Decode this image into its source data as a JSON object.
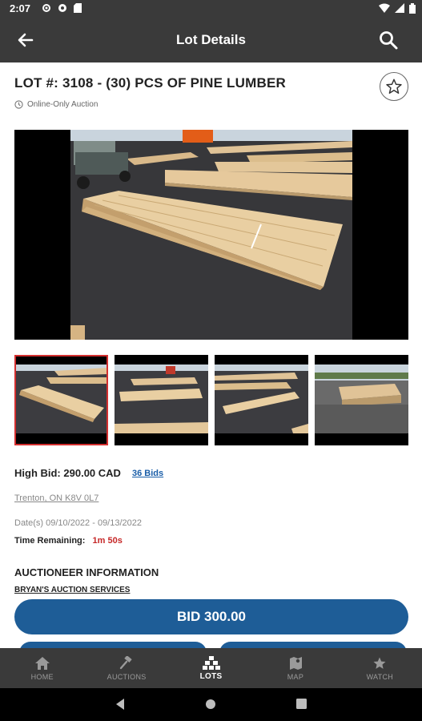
{
  "status_bar": {
    "time": "2:07"
  },
  "app_bar": {
    "title": "Lot Details"
  },
  "lot": {
    "title": "LOT #: 3108 - (30) PCS OF PINE LUMBER",
    "auction_type": "Online-Only Auction",
    "high_bid_label": "High Bid:",
    "high_bid_value": "290.00 CAD",
    "bids_link": "36 Bids",
    "location": "Trenton, ON K8V 0L7",
    "dates": "Date(s) 09/10/2022 - 09/13/2022",
    "time_remaining_label": "Time Remaining:",
    "time_remaining_value": "1m  50s"
  },
  "auctioneer": {
    "heading": "AUCTIONEER INFORMATION",
    "name": "BRYAN'S AUCTION SERVICES"
  },
  "bid_button": {
    "label": "BID 300.00"
  },
  "bottom_nav": [
    {
      "label": "HOME",
      "icon": "home-icon",
      "active": false
    },
    {
      "label": "AUCTIONS",
      "icon": "gavel-icon",
      "active": false
    },
    {
      "label": "LOTS",
      "icon": "lots-icon",
      "active": true
    },
    {
      "label": "MAP",
      "icon": "map-icon",
      "active": false
    },
    {
      "label": "WATCH",
      "icon": "star-icon",
      "active": false
    }
  ],
  "colors": {
    "accent": "#1e5d97",
    "timer": "#c62828",
    "bar": "#3a3a3a",
    "selected_thumb": "#d32f2f"
  }
}
